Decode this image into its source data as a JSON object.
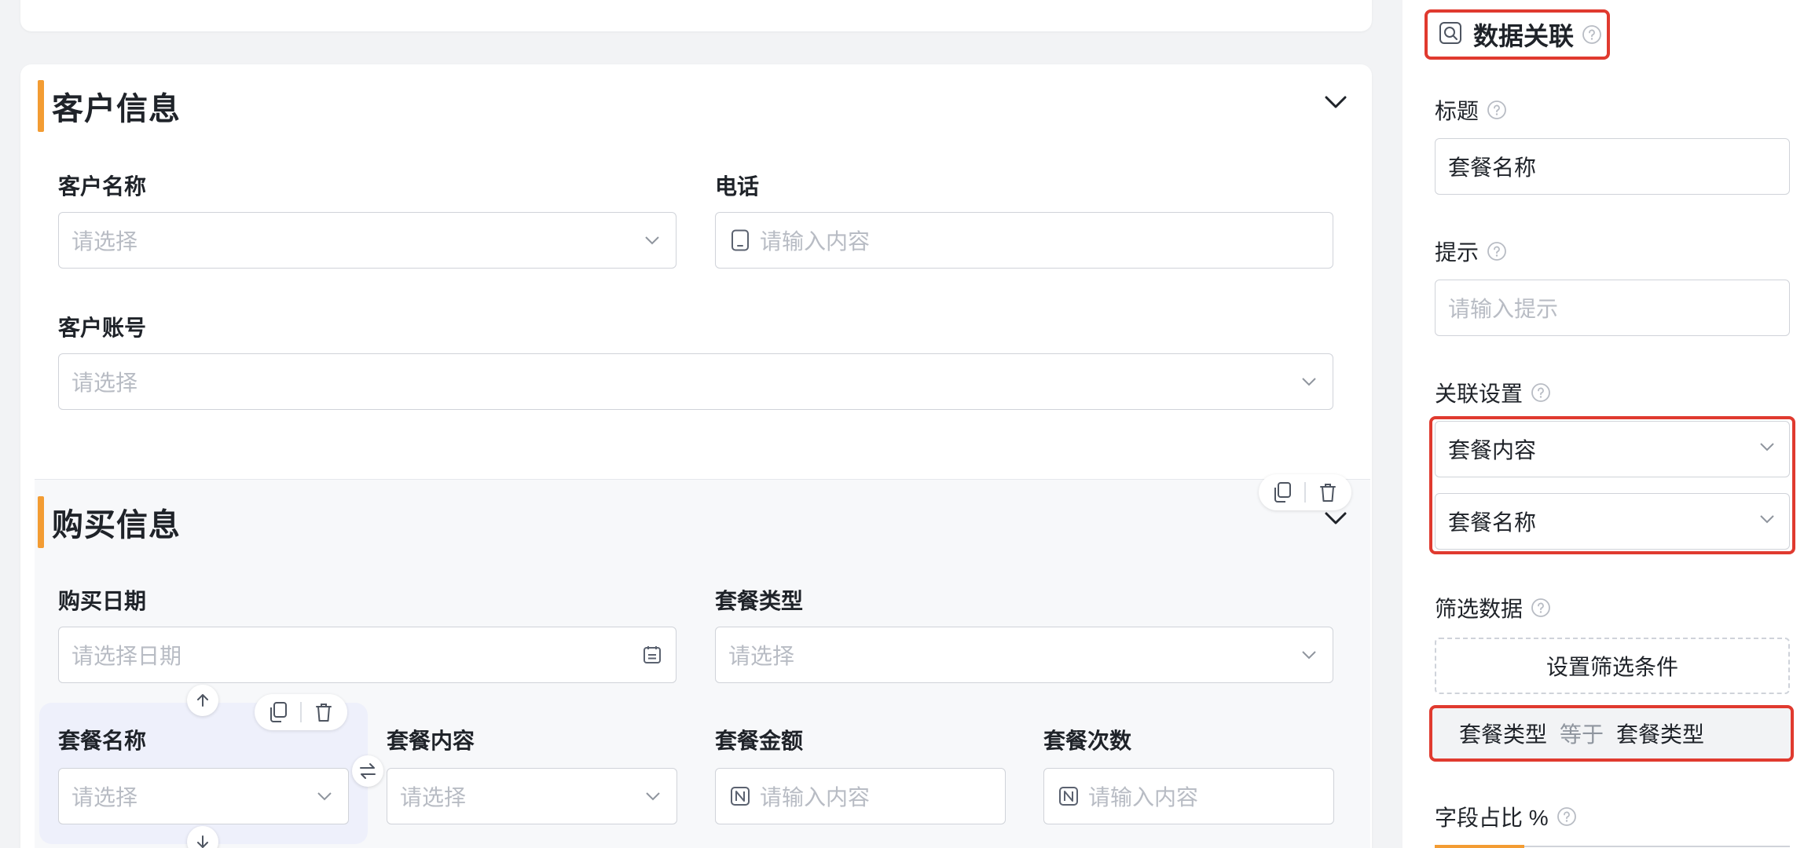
{
  "form": {
    "customer_section": {
      "title": "客户信息",
      "fields": {
        "customer_name": {
          "label": "客户名称",
          "placeholder": "请选择"
        },
        "phone": {
          "label": "电话",
          "placeholder": "请输入内容"
        },
        "customer_account": {
          "label": "客户账号",
          "placeholder": "请选择"
        }
      }
    },
    "purchase_section": {
      "title": "购买信息",
      "fields": {
        "purchase_date": {
          "label": "购买日期",
          "placeholder": "请选择日期"
        },
        "package_type": {
          "label": "套餐类型",
          "placeholder": "请选择"
        },
        "package_name": {
          "label": "套餐名称",
          "placeholder": "请选择"
        },
        "package_content": {
          "label": "套餐内容",
          "placeholder": "请选择"
        },
        "package_amount": {
          "label": "套餐金额",
          "placeholder": "请输入内容"
        },
        "package_count": {
          "label": "套餐次数",
          "placeholder": "请输入内容"
        }
      }
    }
  },
  "panel": {
    "component_title": "数据关联",
    "title_label": "标题",
    "title_value": "套餐名称",
    "hint_label": "提示",
    "hint_placeholder": "请输入提示",
    "relation_label": "关联设置",
    "relation_form": "套餐内容",
    "relation_field": "套餐名称",
    "filter_label": "筛选数据",
    "filter_button": "设置筛选条件",
    "condition": {
      "left": "套餐类型",
      "op": "等于",
      "right": "套餐类型"
    },
    "ratio_label": "字段占比 %"
  },
  "colors": {
    "accent": "#f39c33",
    "highlight": "#e03a2f",
    "selected_bg": "#eef0fb"
  }
}
